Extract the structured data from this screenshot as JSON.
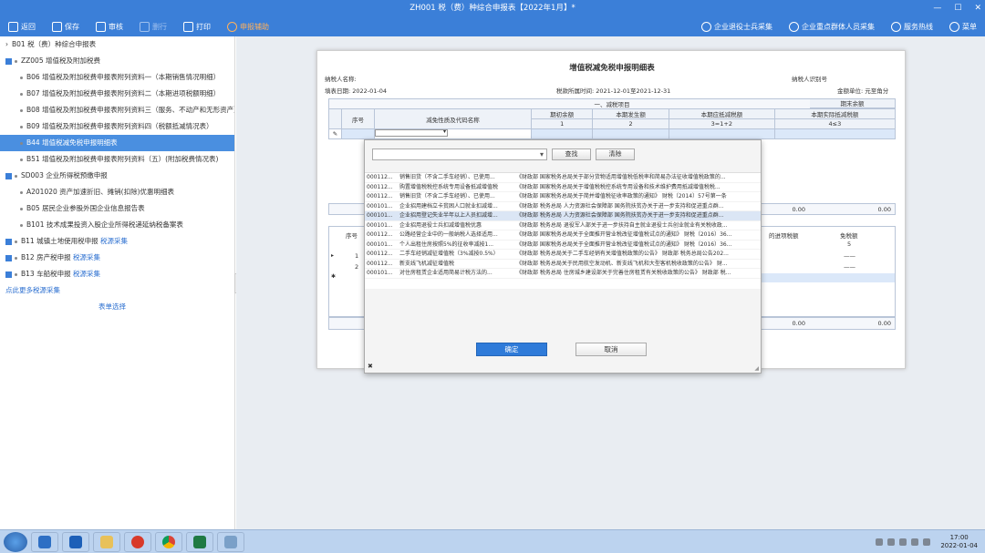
{
  "window": {
    "title": "ZH001 税（费）种综合申报表【2022年1月】*"
  },
  "toolbar": {
    "items": [
      {
        "label": "返回",
        "dim": false
      },
      {
        "label": "保存",
        "dim": false
      },
      {
        "label": "审核",
        "dim": false
      },
      {
        "label": "删行",
        "dim": true
      },
      {
        "label": "打印",
        "dim": false
      }
    ],
    "assist": "申报辅助",
    "right": [
      "企业退役士兵采集",
      "企业重点群体人员采集",
      "服务热线",
      "菜单"
    ]
  },
  "sidebar": {
    "items": [
      {
        "code": "B01",
        "name": "税（费）种综合申报表",
        "level": 0,
        "kind": "arrow"
      },
      {
        "code": "ZZ005",
        "name": "增值税及附加税费",
        "level": 0,
        "kind": "check"
      },
      {
        "code": "B06",
        "name": "增值税及附加税费申报表附列资料一（本期销售情况明细）",
        "level": 1
      },
      {
        "code": "B07",
        "name": "增值税及附加税费申报表附列资料二（本期进项税额明细）",
        "level": 1
      },
      {
        "code": "B08",
        "name": "增值税及附加税费申报表附列资料三（服务、不动产和无形资产）",
        "level": 1
      },
      {
        "code": "B09",
        "name": "增值税及附加税费申报表附列资料四（税额抵减情况表）",
        "level": 1
      },
      {
        "code": "B44",
        "name": "增值税减免税申报明细表",
        "level": 1,
        "selected": true
      },
      {
        "code": "B51",
        "name": "增值税及附加税费申报表附列资料（五）(附加税费情况表)",
        "level": 1
      },
      {
        "code": "SD003",
        "name": "企业所得税预缴申报",
        "level": 0,
        "kind": "check"
      },
      {
        "code": "A201020",
        "name": "资产加速折旧、摊销(扣除)优惠明细表",
        "level": 1
      },
      {
        "code": "B05",
        "name": "居民企业参股外国企业信息报告表",
        "level": 1
      },
      {
        "code": "B101",
        "name": "技术成果投资入股企业所得税递延纳税备案表",
        "level": 1
      },
      {
        "code": "B11",
        "name": "城镇土地使用税申报",
        "level": 0,
        "kind": "check",
        "link": "税源采集"
      },
      {
        "code": "B12",
        "name": "房产税申报",
        "level": 0,
        "kind": "check",
        "link": "税源采集"
      },
      {
        "code": "B13",
        "name": "车船税申报",
        "level": 0,
        "kind": "check",
        "link": "税源采集"
      }
    ],
    "more": "点此更多税源采集",
    "menu_select": "表单选择"
  },
  "form": {
    "title": "增值税减免税申报明细表",
    "taxpayer_name_label": "纳税人名称:",
    "taxpayer_id_label": "纳税人识别号",
    "fill_date": "填表日期: 2022-01-04",
    "period": "税款所属时间: 2021-12-01至2021-12-31",
    "unit": "金额单位: 元至角分",
    "section1": "一、减税项目",
    "cols": {
      "seq": "序号",
      "name": "减免性质及代码名称",
      "c1": "期初余额",
      "c2": "本期发生额",
      "c3": "本期应抵减税额",
      "c4": "本期实际抵减税额",
      "c5": "期末余额"
    },
    "formulas": [
      "1",
      "2",
      "3=1+2",
      "4≤3",
      "5=3-4"
    ],
    "sum_row": [
      "0.00",
      "0.00"
    ],
    "section2_header": "免税额",
    "section2_mid": "的进项税额",
    "section2_num": "5",
    "row_nums": [
      "1",
      "2"
    ],
    "dash": "——",
    "bottom_sum": [
      "0.00",
      "0.00"
    ]
  },
  "modal": {
    "search_label": "查找",
    "clear_label": "清除",
    "rows": [
      {
        "code": "000112...",
        "name": "销售旧货（不含二手车经销）、已使用...",
        "policy": "《财政部 国家税务总局关于部分货物适用增值税低税率和简易办法征收增值税政策的..."
      },
      {
        "code": "000112...",
        "name": "购置增值税税控系统专用设备抵减增值税",
        "policy": "《财政部 国家税务总局关于增值税税控系统专用设备和技术维护费用抵减增值税税..."
      },
      {
        "code": "000112...",
        "name": "销售旧货（不含二手车经销）、已使用...",
        "policy": "《财政部 国家税务总局关于简并增值税征收率政策的通知》 财税（2014）57号第一条"
      },
      {
        "code": "000101...",
        "name": "企业招用建档立卡贫困人口就业扣减增...",
        "policy": "《财政部 税务总局 人力资源社会保障部 国务院扶贫办关于进一步支持和促进重点群..."
      },
      {
        "code": "000101...",
        "name": "企业招用登记失业半年以上人员扣减增...",
        "policy": "《财政部 税务总局 人力资源社会保障部 国务院扶贫办关于进一步支持和促进重点群...",
        "hl": true
      },
      {
        "code": "000101...",
        "name": "企业招用退役士兵扣减增值税优惠",
        "policy": "《财政部 税务总局 退役军人部关于进一步扶持自主就业退役士兵创业就业有关税收政..."
      },
      {
        "code": "000112...",
        "name": "公路经营企业中的一般纳税人选择适用...",
        "policy": "《财政部 国家税务总局关于全面推开营业税改征增值税试点的通知》 财税（2016）36..."
      },
      {
        "code": "000101...",
        "name": "个人出租住房按照5%的征收率减按1...",
        "policy": "《财政部 国家税务总局关于全面推开营业税改征增值税试点的通知》 财税（2016）36..."
      },
      {
        "code": "000112...",
        "name": "二手车经销减征增值税（3%减按0.5%）",
        "policy": "《财政部 税务总局关于二手车经销有关增值税政策的公告》 财政部 税务总局公告202..."
      },
      {
        "code": "000112...",
        "name": "新支线飞机减征增值税",
        "policy": "《财政部 税务总局关于民用航空发动机、新支线飞机和大型客机税收政策的公告》 财..."
      },
      {
        "code": "000101...",
        "name": "对住房租赁企业适用简易计税方法的...",
        "policy": "《财政部 税务总局 住房城乡建设部关于完善住房租赁有关税收政策的公告》 财政部 税..."
      }
    ],
    "ok_label": "确定",
    "cancel_label": "取消"
  },
  "taskbar": {
    "time": "17:00",
    "date": "2022-01-04"
  }
}
